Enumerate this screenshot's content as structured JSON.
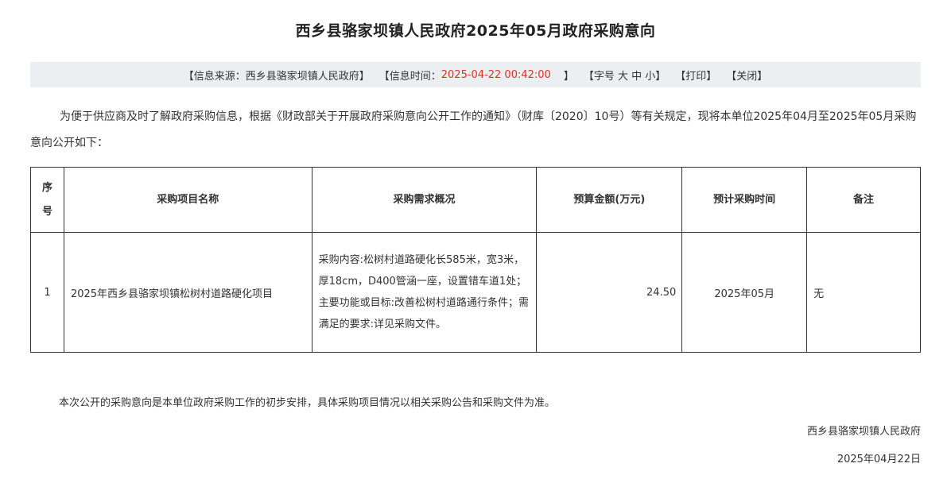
{
  "title": "西乡县骆家坝镇人民政府2025年05月政府采购意向",
  "info_bar": {
    "source_label": "【信息来源：西乡县骆家坝镇人民政府】",
    "time_prefix": "【信息时间：",
    "time_value": "2025-04-22 00:42:00",
    "time_suffix": "】",
    "font_size_label": "【字号 大 中 小】",
    "print_label": "【打印】",
    "close_label": "【关闭】"
  },
  "intro": "为便于供应商及时了解政府采购信息，根据《财政部关于开展政府采购意向公开工作的通知》（财库〔2020〕10号）等有关规定，现将本单位2025年04月至2025年05月采购意向公开如下：",
  "table": {
    "headers": [
      "序号",
      "采购项目名称",
      "采购需求概况",
      "预算金额(万元)",
      "预计采购时间",
      "备注"
    ],
    "rows": [
      {
        "no": "1",
        "name": "2025年西乡县骆家坝镇松树村道路硬化项目",
        "desc": "采购内容:松树村道路硬化长585米，宽3米，厚18cm，D400管涵一座，设置错车道1处；主要功能或目标:改善松树村道路通行条件；需满足的要求:详见采购文件。",
        "amount": "24.50",
        "time": "2025年05月",
        "note": "无"
      }
    ]
  },
  "footer_note": "本次公开的采购意向是本单位政府采购工作的初步安排，具体采购项目情况以相关采购公告和采购文件为准。",
  "signature": "西乡县骆家坝镇人民政府",
  "date": "2025年04月22日",
  "colors": {
    "time_red": "#e0301e",
    "info_bg": "#eceff2",
    "text": "#333333"
  }
}
